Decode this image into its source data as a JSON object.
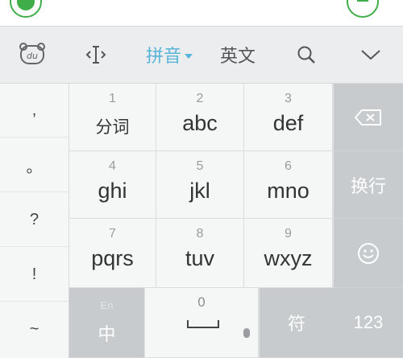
{
  "toolbar": {
    "logo_icon_label": "du",
    "cursor_icon_label": "<I>",
    "pinyin_label": "拼音",
    "english_label": "英文",
    "search_icon_label": "Q"
  },
  "symbols": [
    ",",
    "。",
    "?",
    "!",
    "~"
  ],
  "keys": [
    {
      "num": "1",
      "label": "分词"
    },
    {
      "num": "2",
      "label": "abc"
    },
    {
      "num": "3",
      "label": "def"
    },
    {
      "num": "4",
      "label": "ghi"
    },
    {
      "num": "5",
      "label": "jkl"
    },
    {
      "num": "6",
      "label": "mno"
    },
    {
      "num": "7",
      "label": "pqrs"
    },
    {
      "num": "8",
      "label": "tuv"
    },
    {
      "num": "9",
      "label": "wxyz"
    }
  ],
  "function_keys": {
    "enter_label": "换行",
    "lang_small": "En",
    "lang_big": "中",
    "space_num": "0",
    "symbol_label": "符",
    "numbers_label": "123"
  },
  "colors": {
    "accent": "#58b4d8",
    "top_icon_green": "#3fae49",
    "key_bg": "#f5f6f6",
    "function_key_bg": "#c7cbcd"
  }
}
